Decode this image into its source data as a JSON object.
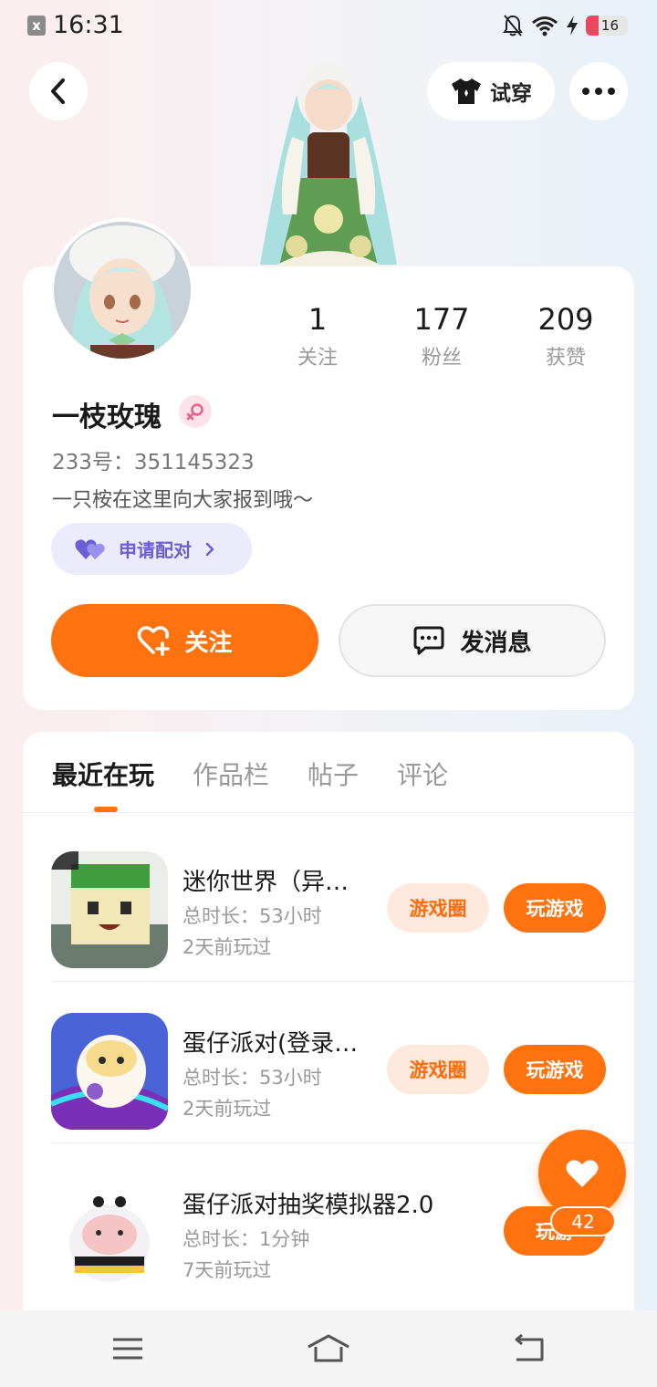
{
  "status_bar": {
    "time": "16:31",
    "battery": "16",
    "icons": [
      "notification-off-icon",
      "wifi-icon",
      "charging-icon",
      "battery-icon"
    ]
  },
  "header": {
    "back_icon": "chevron-left-icon",
    "try_on_label": "试穿",
    "try_on_icon": "shirt-icon",
    "more_icon": "more-dots-icon"
  },
  "profile": {
    "username": "一枝玫瑰",
    "gender_icon": "female-icon",
    "id_line": "233号：351145323",
    "bio": "一只桉在这里向大家报到哦～",
    "pair_label": "申请配对",
    "stats": [
      {
        "value": "1",
        "label": "关注"
      },
      {
        "value": "177",
        "label": "粉丝"
      },
      {
        "value": "209",
        "label": "获赞"
      }
    ],
    "follow_label": "关注",
    "message_label": "发消息"
  },
  "tabs": [
    "最近在玩",
    "作品栏",
    "帖子",
    "评论"
  ],
  "active_tab": 0,
  "games": [
    {
      "title": "迷你世界（异…",
      "duration": "总时长：53小时",
      "last_played": "2天前玩过",
      "circle_label": "游戏圈",
      "play_label": "玩游戏"
    },
    {
      "title": "蛋仔派对(登录…",
      "duration": "总时长：53小时",
      "last_played": "2天前玩过",
      "circle_label": "游戏圈",
      "play_label": "玩游戏"
    },
    {
      "title": "蛋仔派对抽奖模拟器2.0",
      "duration": "总时长：1分钟",
      "last_played": "7天前玩过",
      "play_label": "玩游"
    }
  ],
  "like_fab": {
    "count": "42",
    "icon": "heart-icon"
  },
  "colors": {
    "accent": "#ff7210",
    "pair": "#6a5fd6",
    "card": "#ffffff"
  }
}
